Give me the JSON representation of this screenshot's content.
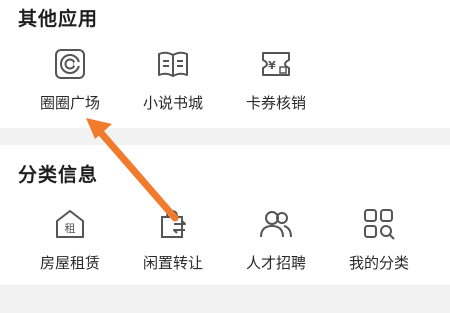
{
  "sections": [
    {
      "title": "其他应用",
      "items": [
        {
          "label": "圈圈广场",
          "icon": "circle-square-icon"
        },
        {
          "label": "小说书城",
          "icon": "open-book-icon"
        },
        {
          "label": "卡券核销",
          "icon": "yen-ticket-icon"
        }
      ]
    },
    {
      "title": "分类信息",
      "items": [
        {
          "label": "房屋租赁",
          "icon": "house-rent-icon",
          "glyph": "租"
        },
        {
          "label": "闲置转让",
          "icon": "exchange-bag-icon"
        },
        {
          "label": "人才招聘",
          "icon": "people-icon"
        },
        {
          "label": "我的分类",
          "icon": "grid-search-icon"
        }
      ]
    }
  ],
  "annotation": {
    "arrow_color": "#f07b2c",
    "arrow_icon": "pointer-arrow-icon"
  }
}
